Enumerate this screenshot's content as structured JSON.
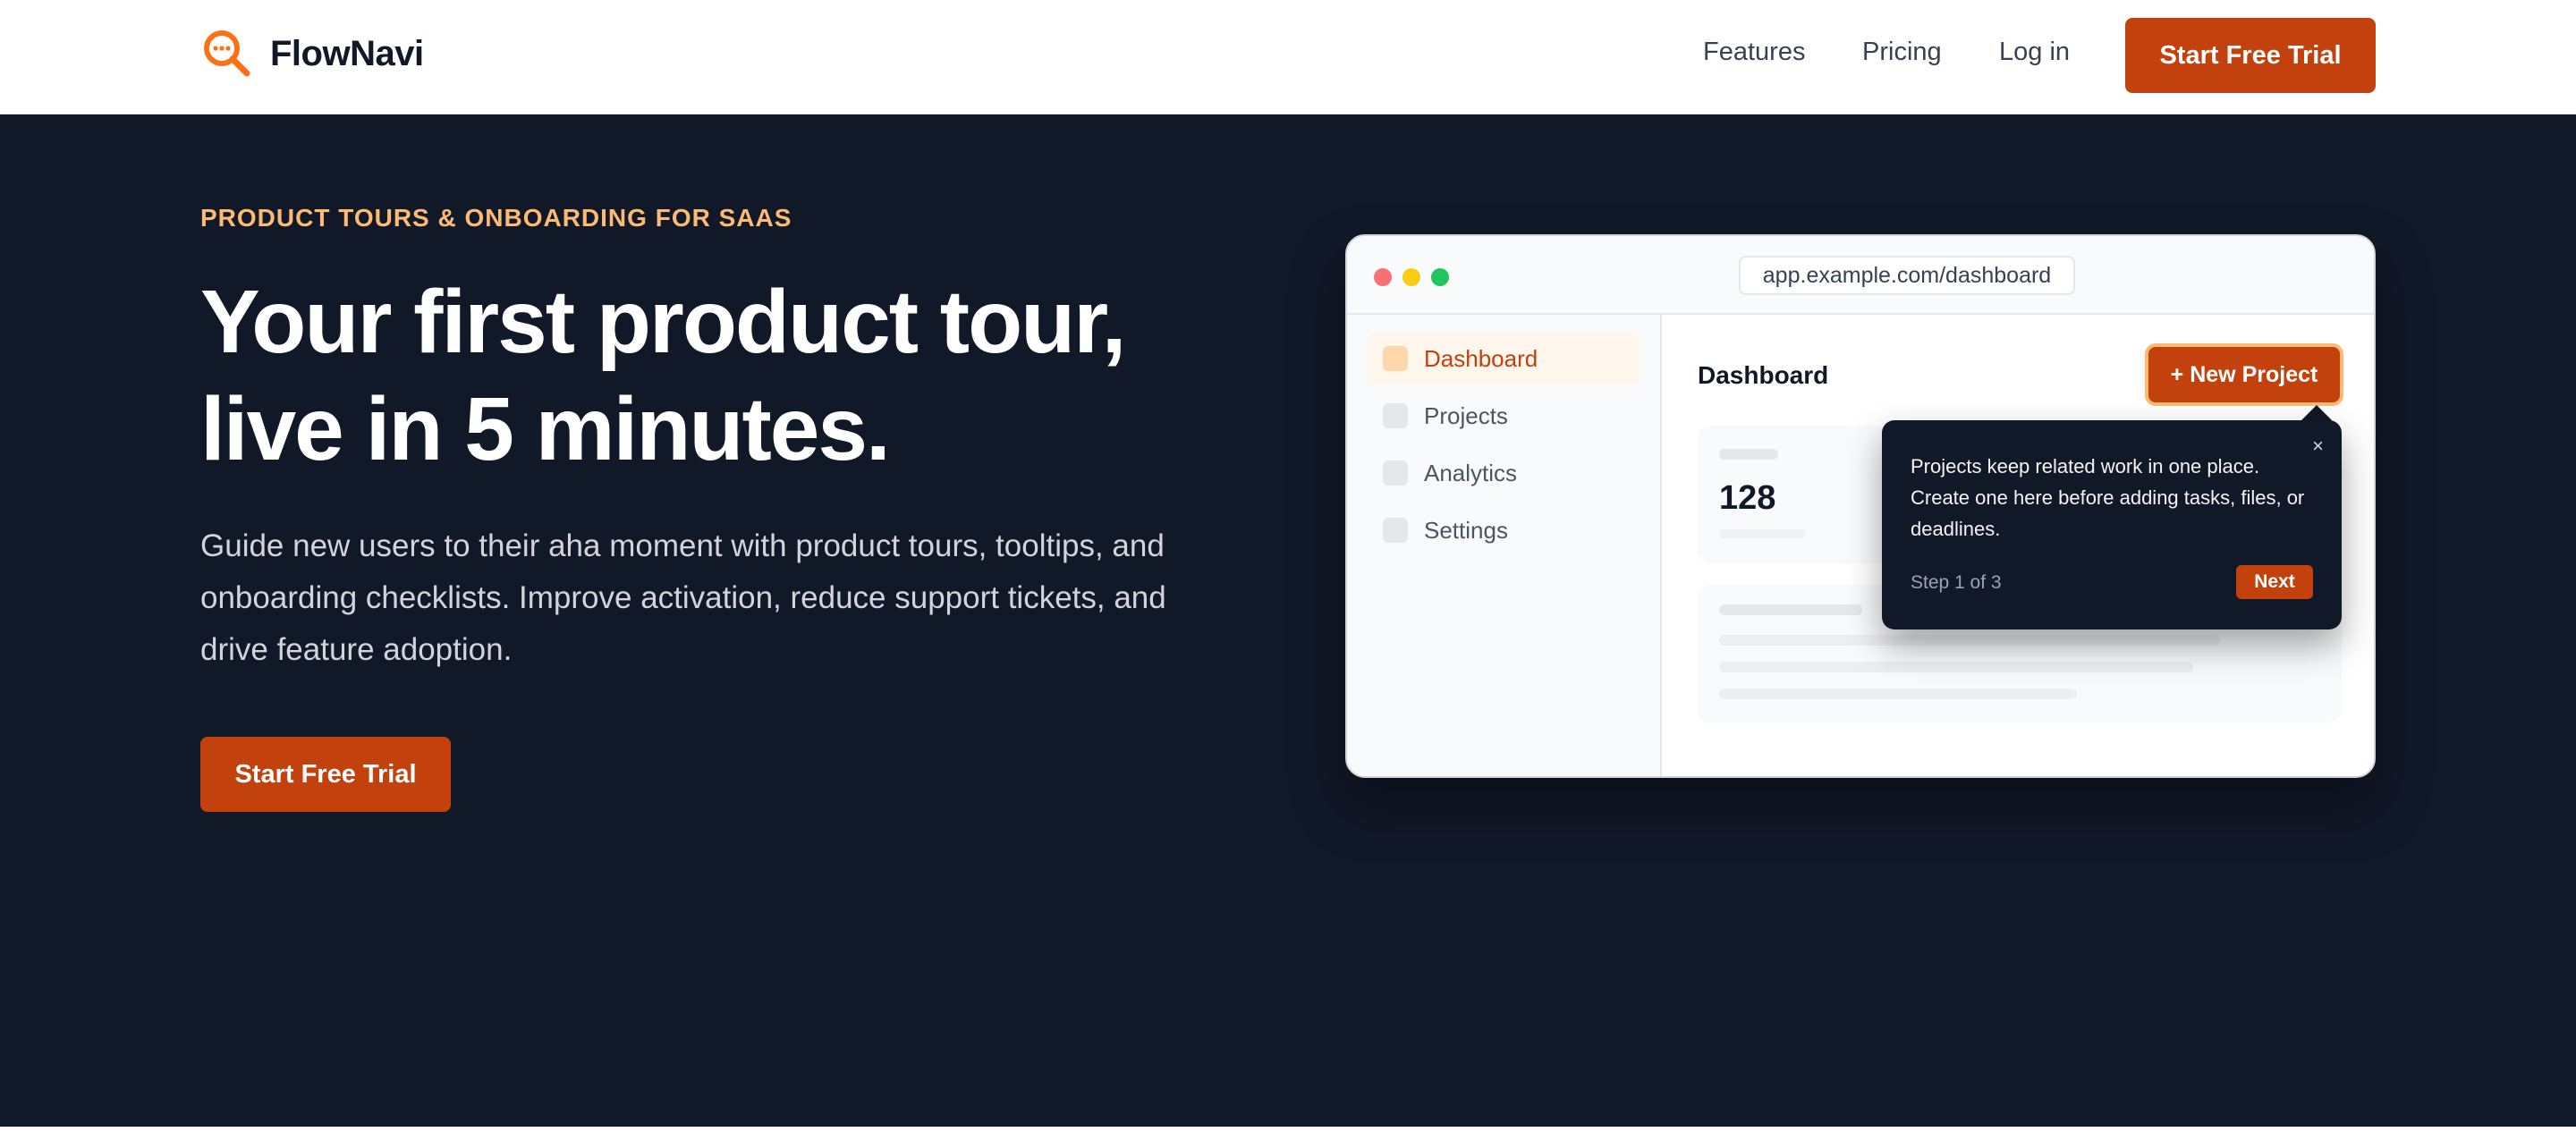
{
  "brand": {
    "name": "FlowNavi",
    "accent": "#c2410c",
    "logo_color": "#f97316"
  },
  "nav": {
    "links": [
      "Features",
      "Pricing",
      "Log in"
    ],
    "cta_label": "Start Free Trial"
  },
  "hero": {
    "eyebrow": "PRODUCT TOURS & ONBOARDING FOR SAAS",
    "headline_line1": "Your first product tour,",
    "headline_line2": "live in 5 minutes.",
    "subtext": "Guide new users to their aha moment with product tours, tooltips, and onboarding checklists. Improve activation, reduce support tickets, and drive feature adoption.",
    "cta_label": "Start Free Trial",
    "background": "#111827"
  },
  "mockup": {
    "url": "app.example.com/dashboard",
    "sidebar": [
      "Dashboard",
      "Projects",
      "Analytics",
      "Settings"
    ],
    "active_item": "Dashboard",
    "page_title": "Dashboard",
    "new_project_label": "+ New Project",
    "stat_value": "128",
    "tooltip": {
      "body": "Projects keep related work in one place. Create one here before adding tasks, files, or deadlines.",
      "step": "Step 1 of 3",
      "next_label": "Next",
      "close_glyph": "×"
    }
  }
}
